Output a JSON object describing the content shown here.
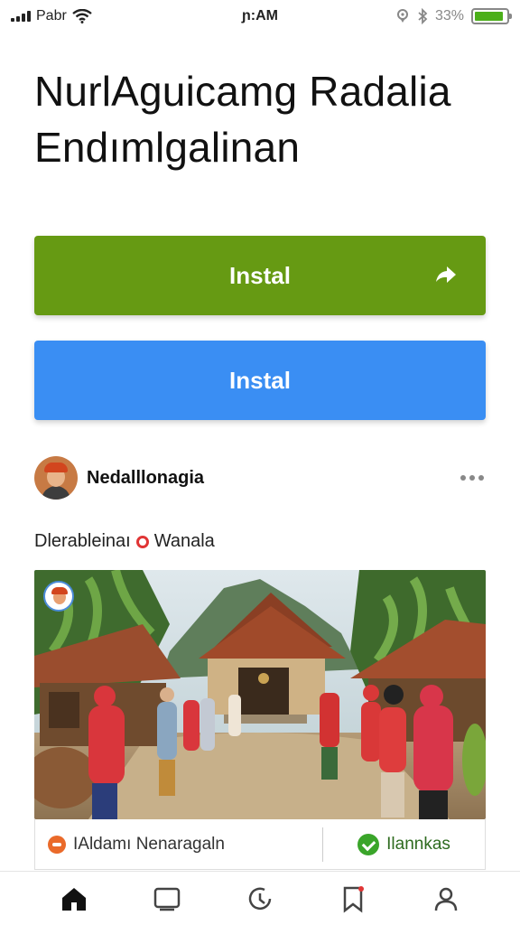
{
  "status_bar": {
    "carrier": "Pabr",
    "time": "ɲ:AM",
    "battery_text": "33%",
    "battery_level": 0.9
  },
  "header": {
    "title_line1": "NurlAguicamg Radalia",
    "title_line2": "Endımlgalinan"
  },
  "buttons": {
    "primary_label": "Instal",
    "secondary_label": "Instal"
  },
  "post": {
    "author": "Nedalllonagia",
    "caption_before": "Dlerablеinaı",
    "caption_after": "Wanala",
    "actions": {
      "left_label": "IAldamı Nenaragaln",
      "right_label": "Ilannkas"
    }
  },
  "tabs": [
    {
      "name": "home-icon",
      "active": true
    },
    {
      "name": "square-icon",
      "active": false
    },
    {
      "name": "clock-icon",
      "active": false
    },
    {
      "name": "bookmark-icon",
      "active": false
    },
    {
      "name": "profile-icon",
      "active": false
    }
  ],
  "colors": {
    "primary_button": "#669a13",
    "secondary_button": "#3a8ef3",
    "accent_green": "#3aa52a",
    "accent_red": "#e03535"
  }
}
